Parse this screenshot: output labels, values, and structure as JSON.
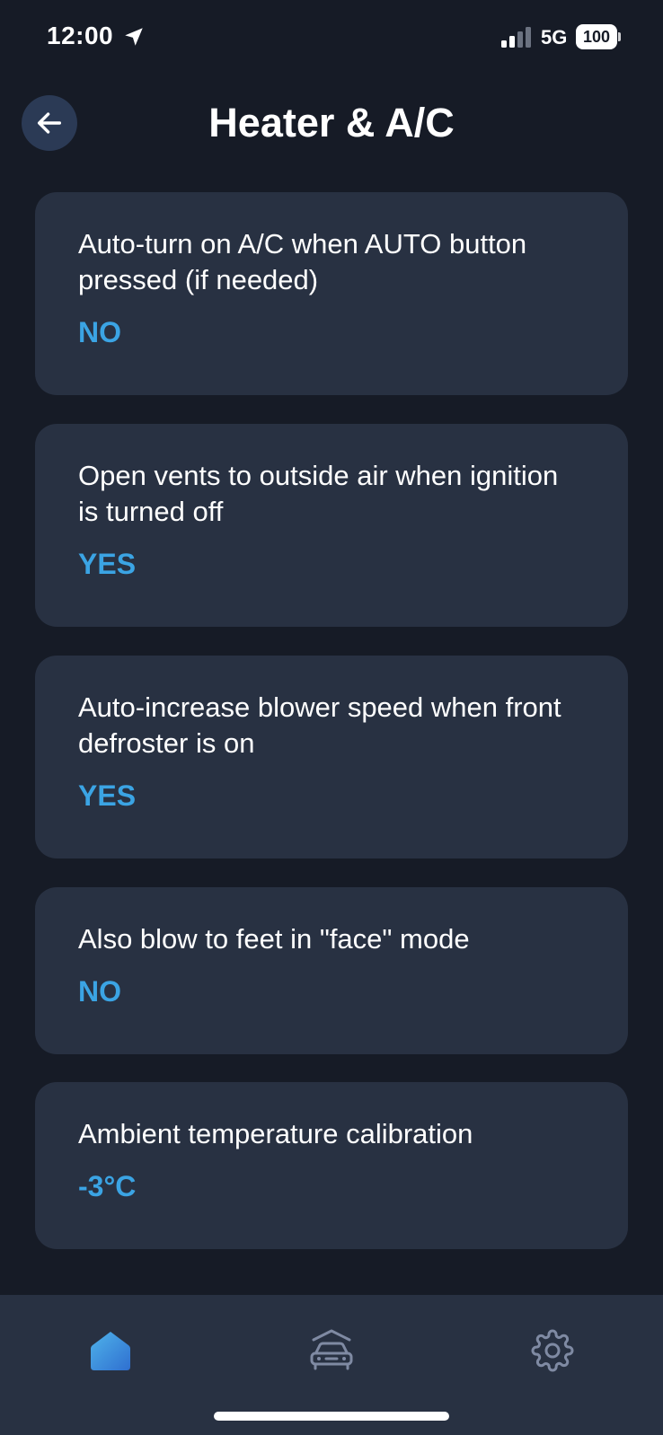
{
  "status_bar": {
    "time": "12:00",
    "network": "5G",
    "battery": "100"
  },
  "header": {
    "title": "Heater & A/C",
    "back_icon": "arrow-left-icon"
  },
  "settings": [
    {
      "label": "Auto-turn on A/C when AUTO button pressed (if needed)",
      "value": "NO"
    },
    {
      "label": "Open vents to outside air when ignition is turned off",
      "value": "YES"
    },
    {
      "label": "Auto-increase blower speed when front defroster is on",
      "value": "YES"
    },
    {
      "label": "Also blow to feet in \"face\" mode",
      "value": "NO"
    },
    {
      "label": "Ambient temperature calibration",
      "value": "-3°C"
    }
  ],
  "bottom_nav": {
    "items": [
      {
        "icon": "home-icon",
        "active": true
      },
      {
        "icon": "car-icon",
        "active": false
      },
      {
        "icon": "gear-icon",
        "active": false
      }
    ]
  },
  "colors": {
    "background": "#161b26",
    "card": "#283142",
    "accent": "#3ba4e4",
    "back_button": "#2b3a55"
  }
}
